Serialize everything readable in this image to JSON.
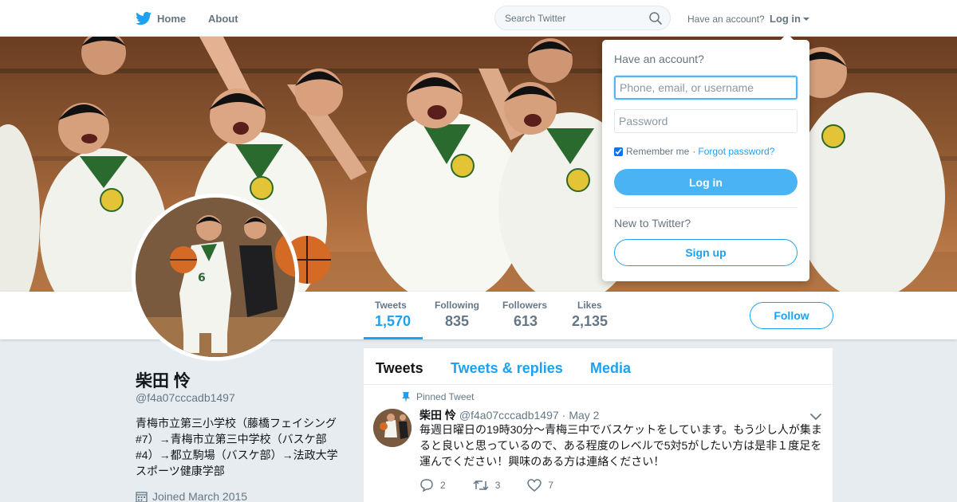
{
  "nav": {
    "home_label": "Home",
    "about_label": "About",
    "search_placeholder": "Search Twitter",
    "have_account": "Have an account?",
    "login_label": "Log in"
  },
  "icons": {
    "brand": "twitter-bird-icon",
    "search": "search-icon",
    "caret": "caret-down-icon",
    "pin": "pin-icon",
    "calendar": "calendar-icon",
    "chevron": "chevron-down-icon",
    "reply": "reply-icon",
    "retweet": "retweet-icon",
    "like": "heart-icon"
  },
  "colors": {
    "accent": "#1da1f2",
    "login_button": "#4ab3f4",
    "muted": "#657786",
    "background": "#e6ecf0"
  },
  "stats": {
    "tweets_label": "Tweets",
    "tweets_value": "1,570",
    "following_label": "Following",
    "following_value": "835",
    "followers_label": "Followers",
    "followers_value": "613",
    "likes_label": "Likes",
    "likes_value": "2,135",
    "follow_button": "Follow"
  },
  "profile": {
    "name": "柴田 怜",
    "handle": "@f4a07cccadb1497",
    "bio": "青梅市立第三小学校（藤橋フェイシング#7）→青梅市立第三中学校（バスケ部#4）→都立駒場（バスケ部）→法政大学スポーツ健康学部",
    "joined": "Joined March 2015"
  },
  "timeline": {
    "tabs": [
      "Tweets",
      "Tweets & replies",
      "Media"
    ],
    "pinned_label": "Pinned Tweet",
    "tweet": {
      "name": "柴田 怜",
      "handle": "@f4a07cccadb1497",
      "dot": "·",
      "date": "May 2",
      "text": "毎週日曜日の19時30分～青梅三中でバスケットをしています。もう少し人が集まると良いと思っているので、ある程度のレベルで5対5がしたい方は是非１度足を運んでください！興味のある方は連絡ください！",
      "replies": "2",
      "retweets": "3",
      "likes": "7"
    }
  },
  "login_dropdown": {
    "title": "Have an account?",
    "username_placeholder": "Phone, email, or username",
    "password_placeholder": "Password",
    "remember_label": "Remember me",
    "separator": "·",
    "forgot_label": "Forgot password?",
    "login_button": "Log in",
    "new_label": "New to Twitter?",
    "signup_button": "Sign up"
  }
}
